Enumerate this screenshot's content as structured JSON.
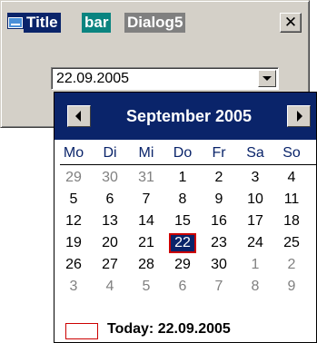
{
  "window": {
    "title_parts": [
      "Title",
      "bar",
      "Dialog5"
    ],
    "close_label": "✕"
  },
  "date_field": {
    "value": "22.09.2005"
  },
  "calendar": {
    "month_label": "September 2005",
    "weekday_headers": [
      "Mo",
      "Di",
      "Mi",
      "Do",
      "Fr",
      "Sa",
      "So"
    ],
    "weeks": [
      [
        {
          "day": "29",
          "in_month": false
        },
        {
          "day": "30",
          "in_month": false
        },
        {
          "day": "31",
          "in_month": false
        },
        {
          "day": "1",
          "in_month": true
        },
        {
          "day": "2",
          "in_month": true
        },
        {
          "day": "3",
          "in_month": true
        },
        {
          "day": "4",
          "in_month": true
        }
      ],
      [
        {
          "day": "5",
          "in_month": true
        },
        {
          "day": "6",
          "in_month": true
        },
        {
          "day": "7",
          "in_month": true
        },
        {
          "day": "8",
          "in_month": true
        },
        {
          "day": "9",
          "in_month": true
        },
        {
          "day": "10",
          "in_month": true
        },
        {
          "day": "11",
          "in_month": true
        }
      ],
      [
        {
          "day": "12",
          "in_month": true
        },
        {
          "day": "13",
          "in_month": true
        },
        {
          "day": "14",
          "in_month": true
        },
        {
          "day": "15",
          "in_month": true
        },
        {
          "day": "16",
          "in_month": true
        },
        {
          "day": "17",
          "in_month": true
        },
        {
          "day": "18",
          "in_month": true
        }
      ],
      [
        {
          "day": "19",
          "in_month": true
        },
        {
          "day": "20",
          "in_month": true
        },
        {
          "day": "21",
          "in_month": true
        },
        {
          "day": "22",
          "in_month": true,
          "selected": true
        },
        {
          "day": "23",
          "in_month": true
        },
        {
          "day": "24",
          "in_month": true
        },
        {
          "day": "25",
          "in_month": true
        }
      ],
      [
        {
          "day": "26",
          "in_month": true
        },
        {
          "day": "27",
          "in_month": true
        },
        {
          "day": "28",
          "in_month": true
        },
        {
          "day": "29",
          "in_month": true
        },
        {
          "day": "30",
          "in_month": true
        },
        {
          "day": "1",
          "in_month": false
        },
        {
          "day": "2",
          "in_month": false
        }
      ],
      [
        {
          "day": "3",
          "in_month": false
        },
        {
          "day": "4",
          "in_month": false
        },
        {
          "day": "5",
          "in_month": false
        },
        {
          "day": "6",
          "in_month": false
        },
        {
          "day": "7",
          "in_month": false
        },
        {
          "day": "8",
          "in_month": false
        },
        {
          "day": "9",
          "in_month": false
        }
      ]
    ],
    "today_label": "Today: 22.09.2005"
  },
  "icons": {
    "window": "window-icon",
    "close": "close-icon",
    "dropdown": "dropdown-arrow-icon",
    "prev": "arrow-left-icon",
    "next": "arrow-right-icon"
  },
  "colors": {
    "title_active": "#0a246a",
    "title_mid": "#0a8480",
    "title_inactive": "#808080",
    "face": "#d4d0c8",
    "selected_day_bg": "#0a246a",
    "today_marker": "#cc0000",
    "muted_day": "#808080"
  }
}
